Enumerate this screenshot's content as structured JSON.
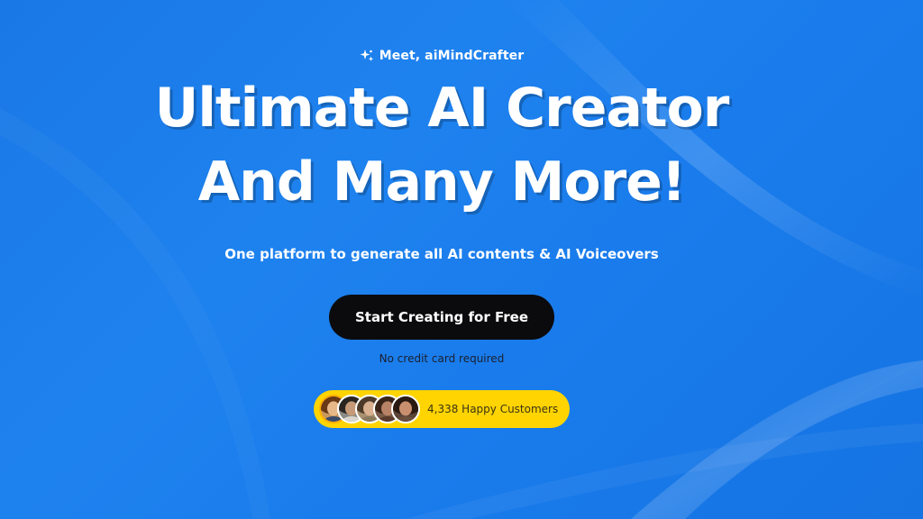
{
  "hero": {
    "eyebrow": "Meet, aiMindCrafter",
    "headline_line1": "Ultimate AI Creator",
    "headline_line2": "And Many More!",
    "subtitle": "One platform to generate all AI contents & AI Voiceovers",
    "cta_label": "Start Creating for Free",
    "note": "No credit card required"
  },
  "social_proof": {
    "customers_text": "4,338 Happy Customers",
    "avatars": [
      {
        "name": "customer-avatar"
      },
      {
        "name": "customer-avatar"
      },
      {
        "name": "customer-avatar"
      },
      {
        "name": "customer-avatar"
      },
      {
        "name": "customer-avatar"
      }
    ]
  },
  "colors": {
    "background": "#1a78e6",
    "cta_background": "#0b0b0d",
    "badge_background": "#ffd400",
    "headline": "#ffffff"
  },
  "icons": {
    "eyebrow_icon": "sparkle-icon"
  }
}
